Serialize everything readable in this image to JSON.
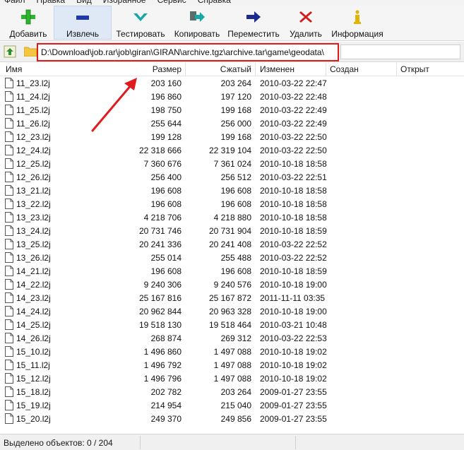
{
  "menu": [
    "Файл",
    "Правка",
    "Вид",
    "Избранное",
    "Сервис",
    "Справка"
  ],
  "toolbar": [
    {
      "label": "Добавить",
      "icon": "plus-icon",
      "color": "#2db52d"
    },
    {
      "label": "Извлечь",
      "icon": "minus-icon",
      "color": "#1d3aa8"
    },
    {
      "label": "Тестировать",
      "icon": "checkmark-icon",
      "color": "#19a6a6"
    },
    {
      "label": "Копировать",
      "icon": "copy-arrow-icon",
      "color": "#19a6a6"
    },
    {
      "label": "Переместить",
      "icon": "move-arrow-icon",
      "color": "#1d2a8f"
    },
    {
      "label": "Удалить",
      "icon": "delete-x-icon",
      "color": "#d41a1a"
    },
    {
      "label": "Информация",
      "icon": "info-icon",
      "color": "#e0b400"
    }
  ],
  "address": {
    "path": "D:\\Download\\job.rar\\job\\giran\\GIRAN\\archive.tgz\\archive.tar\\game\\geodata\\"
  },
  "columns": {
    "name": "Имя",
    "size": "Размер",
    "packed": "Сжатый",
    "modified": "Изменен",
    "created": "Создан",
    "opened": "Открыт"
  },
  "files": [
    {
      "name": "11_23.l2j",
      "size": "203 160",
      "packed": "203 264",
      "modified": "2010-03-22 22:47"
    },
    {
      "name": "11_24.l2j",
      "size": "196 860",
      "packed": "197 120",
      "modified": "2010-03-22 22:48"
    },
    {
      "name": "11_25.l2j",
      "size": "198 750",
      "packed": "199 168",
      "modified": "2010-03-22 22:49"
    },
    {
      "name": "11_26.l2j",
      "size": "255 644",
      "packed": "256 000",
      "modified": "2010-03-22 22:49"
    },
    {
      "name": "12_23.l2j",
      "size": "199 128",
      "packed": "199 168",
      "modified": "2010-03-22 22:50"
    },
    {
      "name": "12_24.l2j",
      "size": "22 318 666",
      "packed": "22 319 104",
      "modified": "2010-03-22 22:50"
    },
    {
      "name": "12_25.l2j",
      "size": "7 360 676",
      "packed": "7 361 024",
      "modified": "2010-10-18 18:58"
    },
    {
      "name": "12_26.l2j",
      "size": "256 400",
      "packed": "256 512",
      "modified": "2010-03-22 22:51"
    },
    {
      "name": "13_21.l2j",
      "size": "196 608",
      "packed": "196 608",
      "modified": "2010-10-18 18:58"
    },
    {
      "name": "13_22.l2j",
      "size": "196 608",
      "packed": "196 608",
      "modified": "2010-10-18 18:58"
    },
    {
      "name": "13_23.l2j",
      "size": "4 218 706",
      "packed": "4 218 880",
      "modified": "2010-10-18 18:58"
    },
    {
      "name": "13_24.l2j",
      "size": "20 731 746",
      "packed": "20 731 904",
      "modified": "2010-10-18 18:59"
    },
    {
      "name": "13_25.l2j",
      "size": "20 241 336",
      "packed": "20 241 408",
      "modified": "2010-03-22 22:52"
    },
    {
      "name": "13_26.l2j",
      "size": "255 014",
      "packed": "255 488",
      "modified": "2010-03-22 22:52"
    },
    {
      "name": "14_21.l2j",
      "size": "196 608",
      "packed": "196 608",
      "modified": "2010-10-18 18:59"
    },
    {
      "name": "14_22.l2j",
      "size": "9 240 306",
      "packed": "9 240 576",
      "modified": "2010-10-18 19:00"
    },
    {
      "name": "14_23.l2j",
      "size": "25 167 816",
      "packed": "25 167 872",
      "modified": "2011-11-11 03:35"
    },
    {
      "name": "14_24.l2j",
      "size": "20 962 844",
      "packed": "20 963 328",
      "modified": "2010-10-18 19:00"
    },
    {
      "name": "14_25.l2j",
      "size": "19 518 130",
      "packed": "19 518 464",
      "modified": "2010-03-21 10:48"
    },
    {
      "name": "14_26.l2j",
      "size": "268 874",
      "packed": "269 312",
      "modified": "2010-03-22 22:53"
    },
    {
      "name": "15_10.l2j",
      "size": "1 496 860",
      "packed": "1 497 088",
      "modified": "2010-10-18 19:02"
    },
    {
      "name": "15_11.l2j",
      "size": "1 496 792",
      "packed": "1 497 088",
      "modified": "2010-10-18 19:02"
    },
    {
      "name": "15_12.l2j",
      "size": "1 496 796",
      "packed": "1 497 088",
      "modified": "2010-10-18 19:02"
    },
    {
      "name": "15_18.l2j",
      "size": "202 782",
      "packed": "203 264",
      "modified": "2009-01-27 23:55"
    },
    {
      "name": "15_19.l2j",
      "size": "214 954",
      "packed": "215 040",
      "modified": "2009-01-27 23:55"
    },
    {
      "name": "15_20.l2j",
      "size": "249 370",
      "packed": "249 856",
      "modified": "2009-01-27 23:55"
    }
  ],
  "status": {
    "text": "Выделено объектов: 0 / 204"
  },
  "annotation_color": "#e01b1b"
}
